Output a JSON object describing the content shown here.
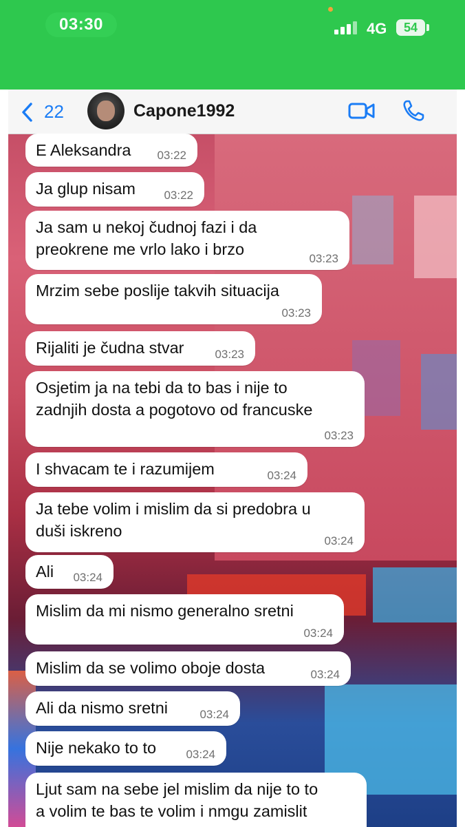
{
  "status_bar": {
    "time": "03:30",
    "network": "4G",
    "battery": "54"
  },
  "header": {
    "back_count": "22",
    "contact_name": "Capone1992"
  },
  "messages": [
    {
      "lines": [
        "E Aleksandra"
      ],
      "time": "03:22"
    },
    {
      "lines": [
        "Ja glup nisam"
      ],
      "time": "03:22"
    },
    {
      "lines": [
        "Ja sam u nekoj čudnoj fazi i da",
        "preokrene me vrlo lako i brzo"
      ],
      "time": "03:23"
    },
    {
      "lines": [
        "Mrzim sebe poslije takvih situacija"
      ],
      "time": "03:23"
    },
    {
      "lines": [
        "Rijaliti je čudna stvar"
      ],
      "time": "03:23"
    },
    {
      "lines": [
        "Osjetim ja na tebi da to bas i nije to",
        "zadnjih dosta a pogotovo od francuske"
      ],
      "time": "03:23"
    },
    {
      "lines": [
        "I shvacam te i razumijem"
      ],
      "time": "03:24"
    },
    {
      "lines": [
        "Ja tebe volim i mislim da si predobra u",
        "duši iskreno"
      ],
      "time": "03:24"
    },
    {
      "lines": [
        "Ali"
      ],
      "time": "03:24"
    },
    {
      "lines": [
        "Mislim da mi nismo generalno sretni"
      ],
      "time": "03:24"
    },
    {
      "lines": [
        "Mislim da se volimo oboje dosta"
      ],
      "time": "03:24"
    },
    {
      "lines": [
        "Ali da nismo sretni"
      ],
      "time": "03:24"
    },
    {
      "lines": [
        "Nije nekako to to"
      ],
      "time": "03:24"
    },
    {
      "lines": [
        "Ljut sam na sebe jel mislim da nije to to",
        "a volim te bas te volim i nmgu zamislit"
      ],
      "time": ""
    }
  ]
}
